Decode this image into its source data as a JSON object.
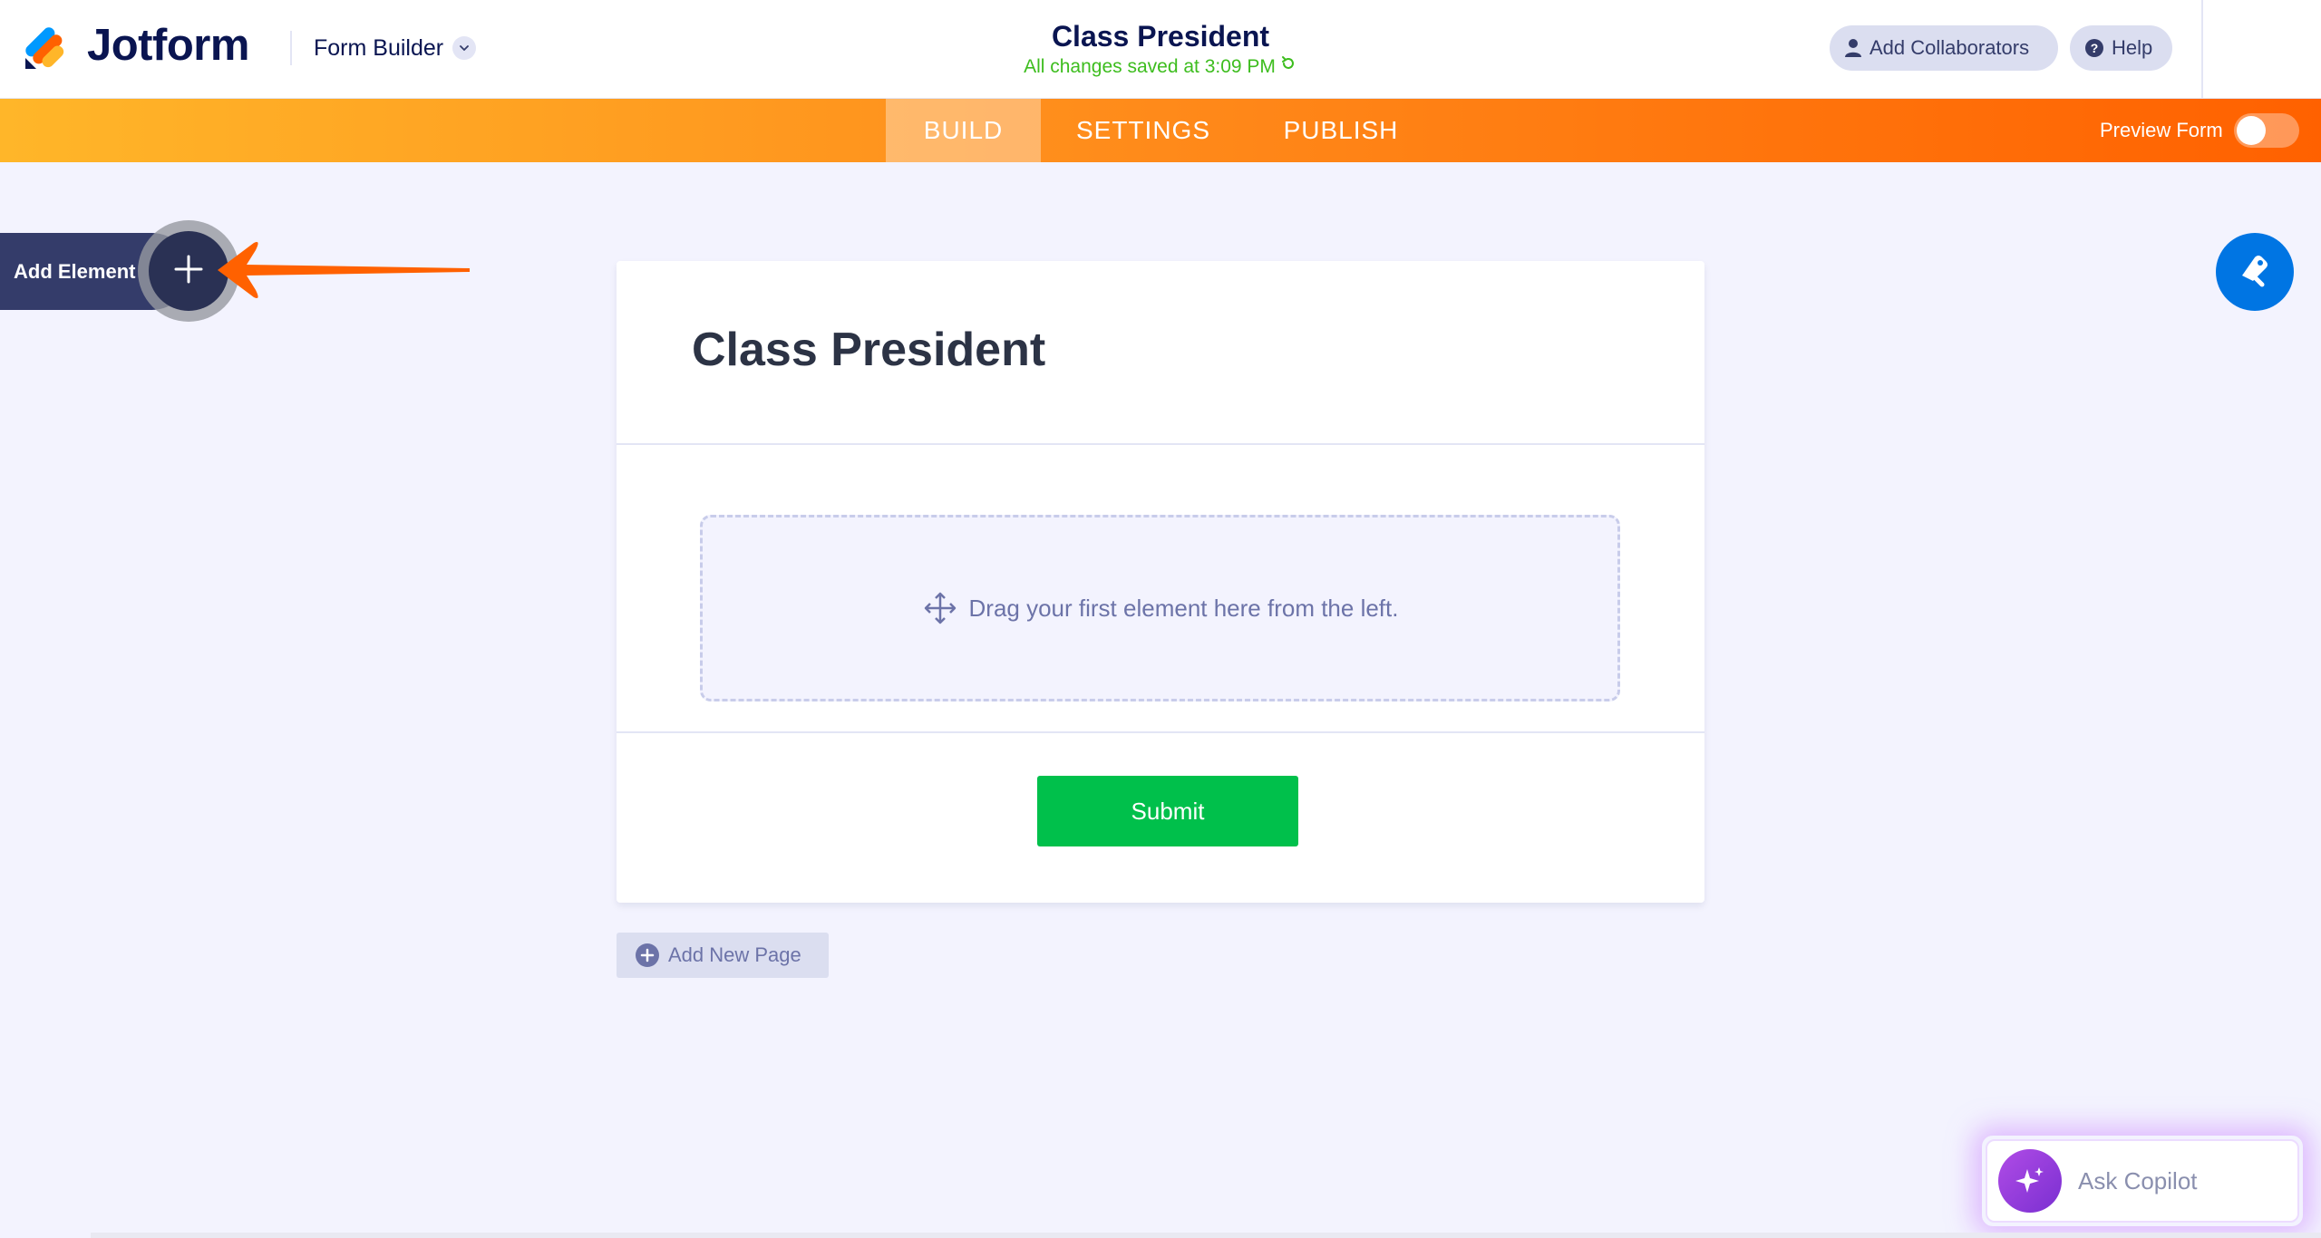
{
  "header": {
    "logo_text": "Jotform",
    "app_switcher_label": "Form Builder",
    "form_title": "Class President",
    "save_status": "All changes saved at 3:09 PM",
    "collaborators_label": "Add Collaborators",
    "help_label": "Help"
  },
  "nav": {
    "tabs": [
      {
        "label": "BUILD",
        "active": true
      },
      {
        "label": "SETTINGS",
        "active": false
      },
      {
        "label": "PUBLISH",
        "active": false
      }
    ],
    "preview_label": "Preview Form",
    "preview_enabled": false
  },
  "sidebar": {
    "add_element_label": "Add Element"
  },
  "form": {
    "heading": "Class President",
    "dropzone_text": "Drag your first element here from the left.",
    "submit_label": "Submit",
    "add_page_label": "Add New Page"
  },
  "copilot": {
    "label": "Ask Copilot"
  },
  "colors": {
    "nav_gradient_start": "#ffb629",
    "nav_gradient_end": "#ff6100",
    "submit_green": "#00c04b",
    "saved_green": "#3dbd1e",
    "designer_blue": "#0075e3",
    "sidebar_dark": "#343c6a",
    "annotation_arrow": "#ff6100"
  }
}
